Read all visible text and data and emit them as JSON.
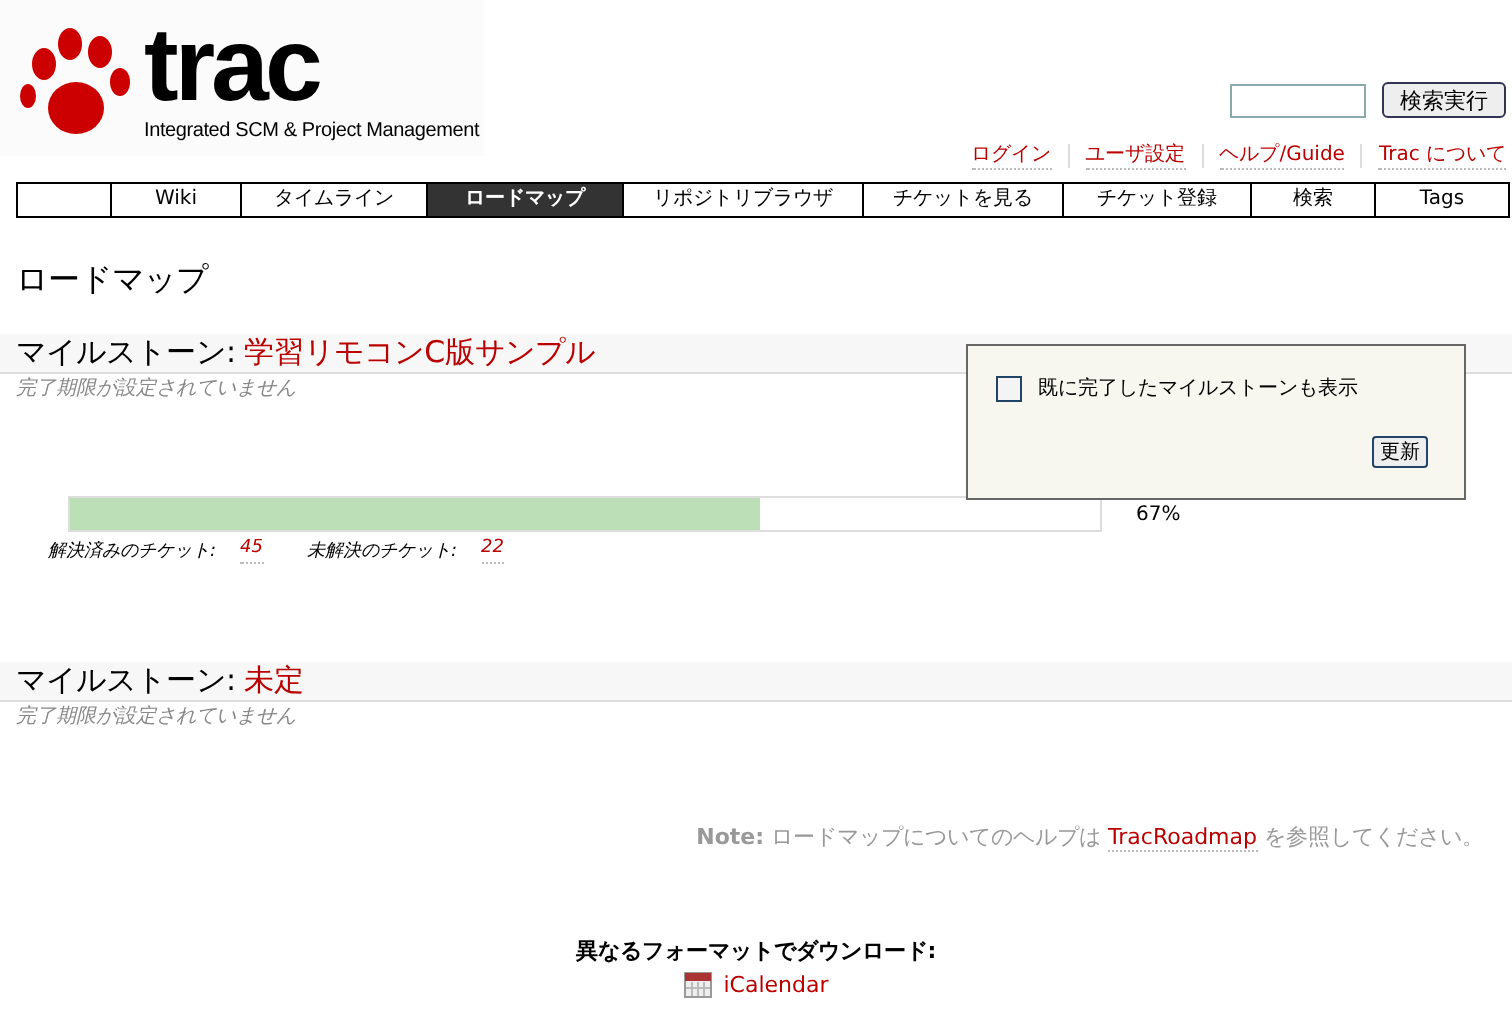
{
  "logo": {
    "wordmark": "trac",
    "tagline": "Integrated SCM & Project Management"
  },
  "search": {
    "button": "検索実行"
  },
  "meta_nav": [
    "ログイン",
    "ユーザ設定",
    "ヘルプ/Guide",
    "Trac について"
  ],
  "main_nav": [
    {
      "label": "Wiki",
      "selected": false
    },
    {
      "label": "タイムライン",
      "selected": false
    },
    {
      "label": "ロードマップ",
      "selected": true
    },
    {
      "label": "リポジトリブラウザ",
      "selected": false
    },
    {
      "label": "チケットを見る",
      "selected": false
    },
    {
      "label": "チケット登録",
      "selected": false
    },
    {
      "label": "検索",
      "selected": false
    },
    {
      "label": "Tags",
      "selected": false
    }
  ],
  "page_title": "ロードマップ",
  "options": {
    "label": "既に完了したマイルストーンも表示",
    "checked": false,
    "button": "更新"
  },
  "milestones": [
    {
      "prefix": "マイルストーン:",
      "name": "学習リモコンC版サンプル",
      "due": "完了期限が設定されていません",
      "progress": {
        "level": 0.67,
        "percent": "67%",
        "stats": [
          {
            "label": "解決済みのチケット:",
            "count": "45"
          },
          {
            "label": "未解決のチケット:",
            "count": "22"
          }
        ]
      }
    },
    {
      "prefix": "マイルストーン:",
      "name": "未定",
      "due": "完了期限が設定されていません"
    }
  ],
  "note": {
    "before": "**Note:** ロードマップについてのヘルプは ",
    "link": "TracRoadmap",
    "after": " を参照してください。"
  },
  "download": {
    "title": "異なるフォーマットでダウンロード:",
    "formats": [
      "iCalendar"
    ]
  }
}
